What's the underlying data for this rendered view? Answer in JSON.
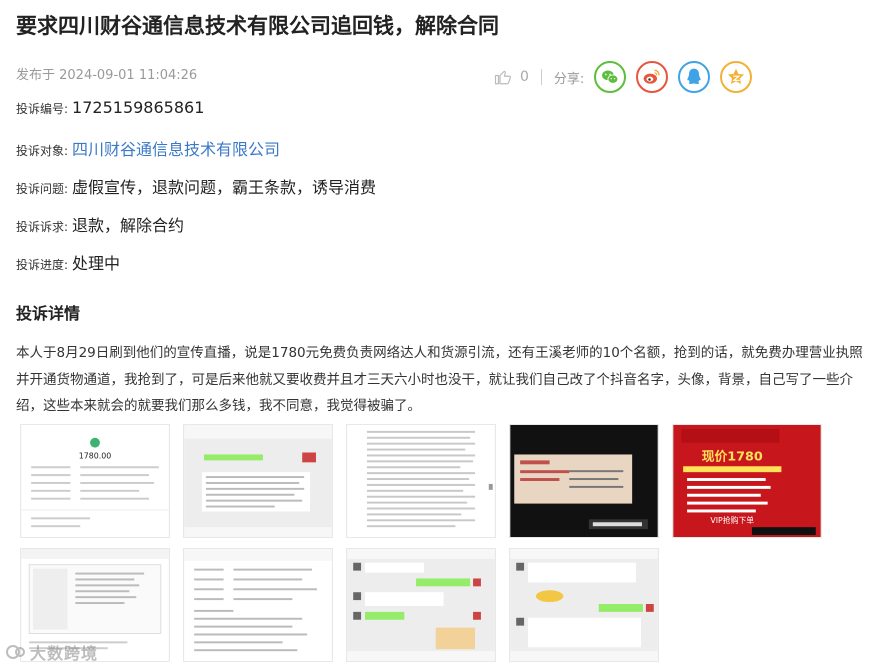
{
  "page": {
    "title": "要求四川财谷通信息技术有限公司追回钱，解除合同",
    "publish_time": "发布于 2024-09-01 11:04:26"
  },
  "actions": {
    "like_count": "0",
    "share_label": "分享:",
    "share_targets": [
      "wechat-icon",
      "weibo-icon",
      "qq-icon",
      "qzone-icon"
    ],
    "share_colors": {
      "wechat": "#5dbd3c",
      "weibo": "#e8543e",
      "qq": "#3fa3e6",
      "qzone": "#f2b135"
    }
  },
  "complaint": {
    "number_label": "投诉编号:",
    "number_value": "1725159865861",
    "target_label": "投诉对象:",
    "target_value": "四川财谷通信息技术有限公司",
    "issue_label": "投诉问题:",
    "issue_value": "虚假宣传，退款问题，霸王条款，诱导消费",
    "demand_label": "投诉诉求:",
    "demand_value": "退款，解除合约",
    "progress_label": "投诉进度:",
    "progress_value": "处理中"
  },
  "detail": {
    "section_title": "投诉详情",
    "text": "本人于8月29日刷到他们的宣传直播，说是1780元免费负责网络达人和货源引流，还有王溪老师的10个名额，抢到的话，就免费办理营业执照并开通货物通道，我抢到了，可是后来他就又要收费并且才三天六小时也没干，就让我们自己改了个抖音名字，头像，背景，自己写了一些介绍，这些本来就会的就要我们那么多钱，我不同意，我觉得被骗了。"
  },
  "gallery": {
    "images": [
      {
        "name": "payment-receipt-screenshot",
        "amount": "1780.00"
      },
      {
        "name": "chat-screenshot-1"
      },
      {
        "name": "contract-document-screenshot"
      },
      {
        "name": "live-stream-screenshot-1"
      },
      {
        "name": "promo-poster-screenshot",
        "price": "现价1780",
        "vip": "VIP抢购下单"
      },
      {
        "name": "order-list-screenshot"
      },
      {
        "name": "chat-screenshot-2"
      },
      {
        "name": "chat-screenshot-3"
      },
      {
        "name": "chat-screenshot-4"
      }
    ]
  },
  "watermark": {
    "text": "大数跨境"
  }
}
